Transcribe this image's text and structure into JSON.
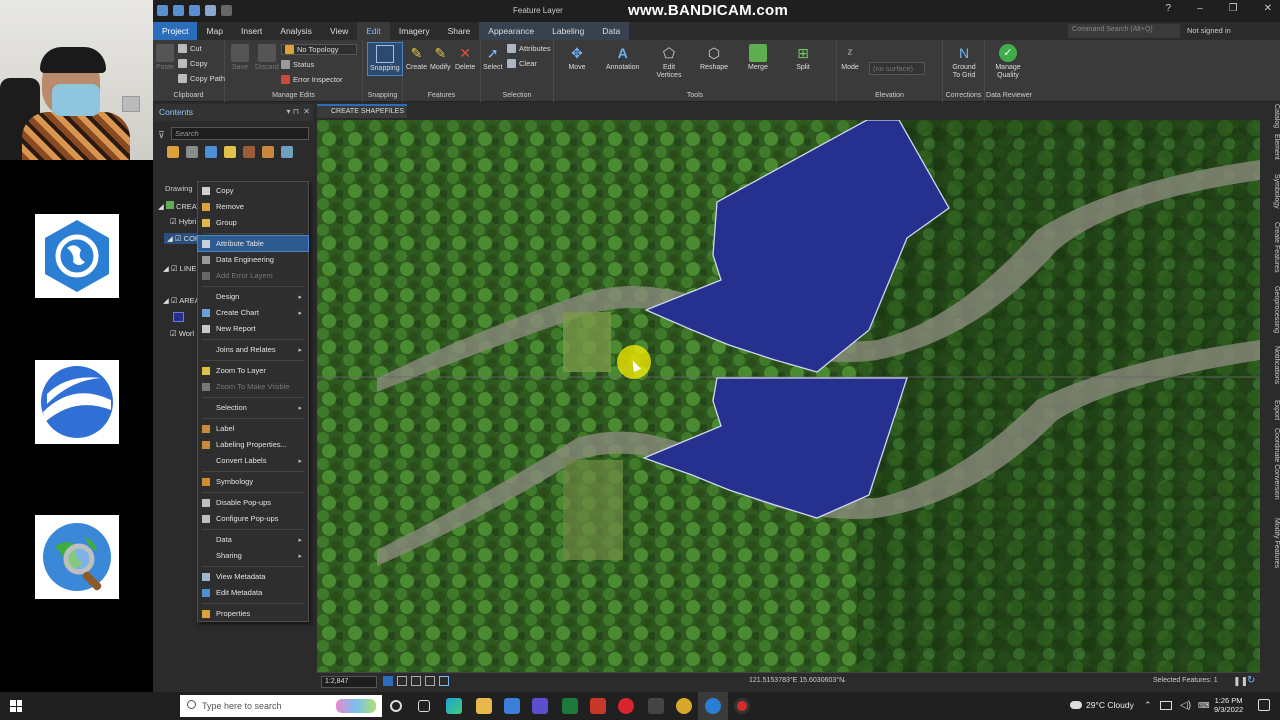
{
  "window": {
    "context_label": "Feature Layer",
    "watermark": "www.BANDICAM.com",
    "controls": [
      "?",
      "–",
      "❐",
      "✕"
    ]
  },
  "ribbon_tabs": [
    "Project",
    "Map",
    "Insert",
    "Analysis",
    "View",
    "Edit",
    "Imagery",
    "Share",
    "Appearance",
    "Labeling",
    "Data"
  ],
  "active_tab": "Edit",
  "command_search": {
    "placeholder": "Command Search (Alt+Q)"
  },
  "signin": "Not signed in",
  "ribbon": {
    "clipboard": {
      "label": "Clipboard",
      "paste": "Paste",
      "cut": "Cut",
      "copy": "Copy",
      "copy_path": "Copy Path"
    },
    "manage_edits": {
      "label": "Manage Edits",
      "save": "Save",
      "discard": "Discard",
      "topology": "No Topology",
      "status": "Status",
      "error_inspector": "Error Inspector"
    },
    "snapping": {
      "label": "Snapping",
      "snapping": "Snapping"
    },
    "features": {
      "label": "Features",
      "create": "Create",
      "modify": "Modify",
      "delete": "Delete"
    },
    "selection": {
      "label": "Selection",
      "select": "Select",
      "attributes": "Attributes",
      "clear": "Clear"
    },
    "tools": {
      "label": "Tools",
      "move": "Move",
      "annotation": "Annotation",
      "edit_vertices": "Edit Vertices",
      "reshape": "Reshape",
      "merge": "Merge",
      "split": "Split"
    },
    "elevation": {
      "label": "Elevation",
      "mode": "Mode",
      "surface": "(no surface)"
    },
    "corrections": {
      "label": "Corrections",
      "ground_to_grid": "Ground To Grid"
    },
    "data_reviewer": {
      "label": "Data Reviewer",
      "manage_quality": "Manage Quality"
    }
  },
  "contents": {
    "title": "Contents",
    "search_placeholder": "Search",
    "drawing_order": "Drawing",
    "tree": [
      "CREAT",
      "Hybri",
      "COR",
      "LINE",
      "AREA",
      "Worl"
    ]
  },
  "context_menu": [
    {
      "label": "Copy",
      "icon": "copy-icon",
      "color": "#d0d0d0"
    },
    {
      "label": "Remove",
      "icon": "remove-icon",
      "color": "#d9a23b"
    },
    {
      "label": "Group",
      "icon": "group-icon",
      "color": "#e0b94a"
    },
    {
      "label": "Attribute Table",
      "icon": "table-icon",
      "color": "#c8d0da",
      "highlight": true
    },
    {
      "label": "Data Engineering",
      "icon": "data-engineering-icon",
      "color": "#9a9a9a"
    },
    {
      "label": "Add Error Layers",
      "icon": "error-layers-icon",
      "color": "#666",
      "disabled": true
    },
    {
      "label": "Design",
      "submenu": true
    },
    {
      "label": "Create Chart",
      "icon": "chart-icon",
      "color": "#6aa0d6",
      "submenu": true
    },
    {
      "label": "New Report",
      "icon": "report-icon",
      "color": "#c9c9c9"
    },
    {
      "label": "Joins and Relates",
      "submenu": true
    },
    {
      "label": "Zoom To Layer",
      "icon": "zoom-layer-icon",
      "color": "#d9c14a"
    },
    {
      "label": "Zoom To Make Visible",
      "icon": "zoom-visible-icon",
      "color": "#777",
      "disabled": true
    },
    {
      "label": "Selection",
      "submenu": true
    },
    {
      "label": "Label",
      "icon": "label-icon",
      "color": "#c88a3a"
    },
    {
      "label": "Labeling Properties...",
      "icon": "labeling-icon",
      "color": "#c88a3a"
    },
    {
      "label": "Convert Labels",
      "submenu": true
    },
    {
      "label": "Symbology",
      "icon": "symbology-icon",
      "color": "#d08b2a"
    },
    {
      "label": "Disable Pop-ups",
      "icon": "popup-icon",
      "color": "#bdbdbd"
    },
    {
      "label": "Configure Pop-ups",
      "icon": "configure-popup-icon",
      "color": "#bdbdbd"
    },
    {
      "label": "Data",
      "submenu": true
    },
    {
      "label": "Sharing",
      "submenu": true
    },
    {
      "label": "View Metadata",
      "icon": "metadata-icon",
      "color": "#9fb6d0"
    },
    {
      "label": "Edit Metadata",
      "icon": "edit-metadata-icon",
      "color": "#4f8fd6"
    },
    {
      "label": "Properties",
      "icon": "properties-icon",
      "color": "#d9a23b"
    }
  ],
  "map_tab": "CREATE SHAPEFILES",
  "right_tabs": [
    "Catalog",
    "Element",
    "Symbology",
    "Create Features",
    "Geoprocessing",
    "Notifications",
    "Export",
    "Coordinate Conversion",
    "Modify Features"
  ],
  "statusbar": {
    "scale": "1:2,847",
    "coordinates": "121.5153783°E 15.6030603°N",
    "selected_features": "Selected Features: 1"
  },
  "taskbar": {
    "search_placeholder": "Type here to search",
    "weather": "29°C  Cloudy",
    "time": "1:26 PM",
    "date": "9/3/2022"
  },
  "colors": {
    "polygon": "#26318f",
    "accent": "#2a6ebb",
    "highlight": "#f5ee00"
  }
}
